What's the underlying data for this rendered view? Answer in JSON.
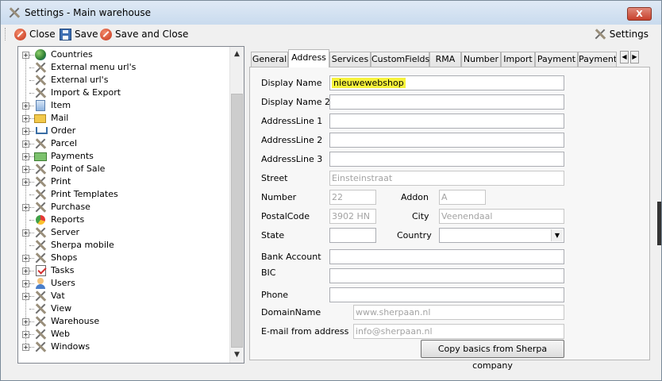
{
  "window": {
    "title": "Settings - Main warehouse",
    "close_glyph": "X"
  },
  "toolbar": {
    "close_label": "Close",
    "save_label": "Save",
    "save_close_label": "Save and Close",
    "settings_label": "Settings"
  },
  "tree": {
    "items": [
      {
        "label": "Countries",
        "icon": "globe-icon",
        "expandable": true
      },
      {
        "label": "External menu url's",
        "icon": "tools-icon",
        "expandable": false
      },
      {
        "label": "External url's",
        "icon": "tools-icon",
        "expandable": false
      },
      {
        "label": "Import & Export",
        "icon": "tools-icon",
        "expandable": false
      },
      {
        "label": "Item",
        "icon": "item-icon",
        "expandable": true
      },
      {
        "label": "Mail",
        "icon": "mail-icon",
        "expandable": true
      },
      {
        "label": "Order",
        "icon": "cart-icon",
        "expandable": true
      },
      {
        "label": "Parcel",
        "icon": "tools-icon",
        "expandable": true
      },
      {
        "label": "Payments",
        "icon": "money-icon",
        "expandable": true
      },
      {
        "label": "Point of Sale",
        "icon": "tools-icon",
        "expandable": true
      },
      {
        "label": "Print",
        "icon": "tools-icon",
        "expandable": true
      },
      {
        "label": "Print Templates",
        "icon": "tools-icon",
        "expandable": false
      },
      {
        "label": "Purchase",
        "icon": "tools-icon",
        "expandable": true
      },
      {
        "label": "Reports",
        "icon": "reports-icon",
        "expandable": false
      },
      {
        "label": "Server",
        "icon": "tools-icon",
        "expandable": true
      },
      {
        "label": "Sherpa mobile",
        "icon": "tools-icon",
        "expandable": false
      },
      {
        "label": "Shops",
        "icon": "tools-icon",
        "expandable": true
      },
      {
        "label": "Tasks",
        "icon": "tasks-icon",
        "expandable": true
      },
      {
        "label": "Users",
        "icon": "users-icon",
        "expandable": true
      },
      {
        "label": "Vat",
        "icon": "tools-icon",
        "expandable": true
      },
      {
        "label": "View",
        "icon": "tools-icon",
        "expandable": false
      },
      {
        "label": "Warehouse",
        "icon": "tools-icon",
        "expandable": true
      },
      {
        "label": "Web",
        "icon": "tools-icon",
        "expandable": true
      },
      {
        "label": "Windows",
        "icon": "tools-icon",
        "expandable": true
      }
    ],
    "expander_glyph": "+",
    "scroll_up_glyph": "▲",
    "scroll_down_glyph": "▼"
  },
  "tabs": {
    "labels": [
      "General",
      "Address",
      "Services",
      "CustomFields",
      "RMA",
      "Number",
      "Import",
      "Payment",
      "Payment"
    ],
    "active": "Address",
    "scroll_left_glyph": "◀",
    "scroll_right_glyph": "▶"
  },
  "address_form": {
    "display_name_label": "Display Name",
    "display_name_value": "nieuwewebshop",
    "display_name2_label": "Display Name 2",
    "display_name2_value": "",
    "address_line1_label": "AddressLine 1",
    "address_line1_value": "",
    "address_line2_label": "AddressLine 2",
    "address_line2_value": "",
    "address_line3_label": "AddressLine 3",
    "address_line3_value": "",
    "street_label": "Street",
    "street_value": "Einsteinstraat",
    "number_label": "Number",
    "number_value": "22",
    "addon_label": "Addon",
    "addon_value": "A",
    "postal_code_label": "PostalCode",
    "postal_code_value": "3902 HN",
    "city_label": "City",
    "city_value": "Veenendaal",
    "state_label": "State",
    "state_value": "",
    "country_label": "Country",
    "country_value": "",
    "bank_account_label": "Bank Account",
    "bank_account_value": "",
    "bic_label": "BIC",
    "bic_value": "",
    "phone_label": "Phone",
    "phone_value": "",
    "domain_name_label": "DomainName",
    "domain_name_value": "www.sherpaan.nl",
    "email_from_label": "E-mail from address",
    "email_from_value": "info@sherpaan.nl",
    "copy_button_label": "Copy basics from Sherpa company",
    "dropdown_glyph": "▼"
  },
  "colors": {
    "highlight": "#f6f23a",
    "close_button": "#c7402b",
    "disabled_text": "#a3a3a3"
  }
}
